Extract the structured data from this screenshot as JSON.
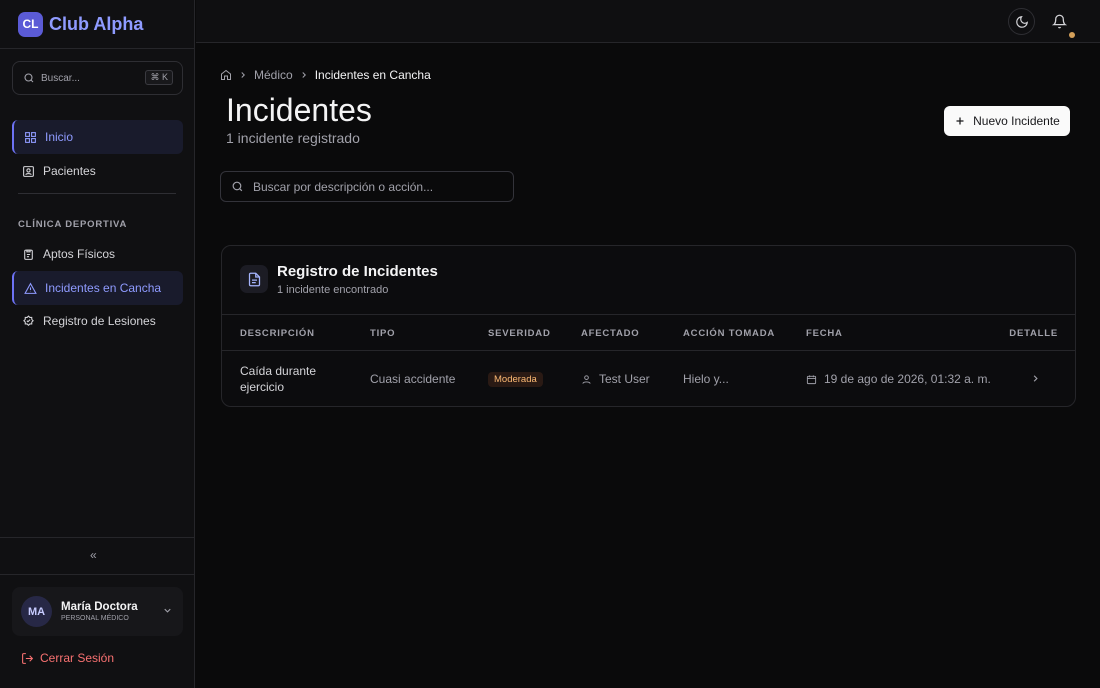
{
  "brand": {
    "logo": "CL",
    "name": "Club Alpha"
  },
  "sidebar": {
    "search_placeholder": "Buscar...",
    "shortcut": "⌘ K",
    "items": [
      {
        "label": "Inicio",
        "icon": "grid-icon"
      },
      {
        "label": "Pacientes",
        "icon": "patient-icon"
      }
    ],
    "section_label": "CLÍNICA DEPORTIVA",
    "section_items": [
      {
        "label": "Aptos Físicos",
        "icon": "clipboard-icon"
      },
      {
        "label": "Incidentes en Cancha",
        "icon": "alert-triangle-icon"
      },
      {
        "label": "Registro de Lesiones",
        "icon": "badge-icon"
      }
    ],
    "collapse": "«",
    "user": {
      "initials": "MA",
      "name": "María Doctora",
      "role": "PERSONAL MÉDICO"
    },
    "logout": "Cerrar Sesión"
  },
  "breadcrumb": {
    "items": [
      "Médico",
      "Incidentes en Cancha"
    ]
  },
  "page": {
    "title": "Incidentes",
    "subtitle": "1 incidente registrado",
    "new_button": "Nuevo Incidente",
    "search_placeholder": "Buscar por descripción o acción..."
  },
  "card": {
    "title": "Registro de Incidentes",
    "subtitle": "1 incidente encontrado",
    "columns": [
      "DESCRIPCIÓN",
      "TIPO",
      "SEVERIDAD",
      "AFECTADO",
      "ACCIÓN TOMADA",
      "FECHA",
      "DETALLE"
    ],
    "rows": [
      {
        "descripcion_1": "Caída durante",
        "descripcion_2": "ejercicio",
        "tipo": "Cuasi accidente",
        "severidad": "Moderada",
        "afectado": "Test User",
        "accion": "Hielo y...",
        "fecha": "19 de ago de 2026, 01:32 a. m."
      }
    ]
  },
  "colors": {
    "accent": "#8f9bff",
    "severity_moderate": "#fdba74",
    "logout": "#f87171",
    "notification_dot": "#d4a05a"
  }
}
